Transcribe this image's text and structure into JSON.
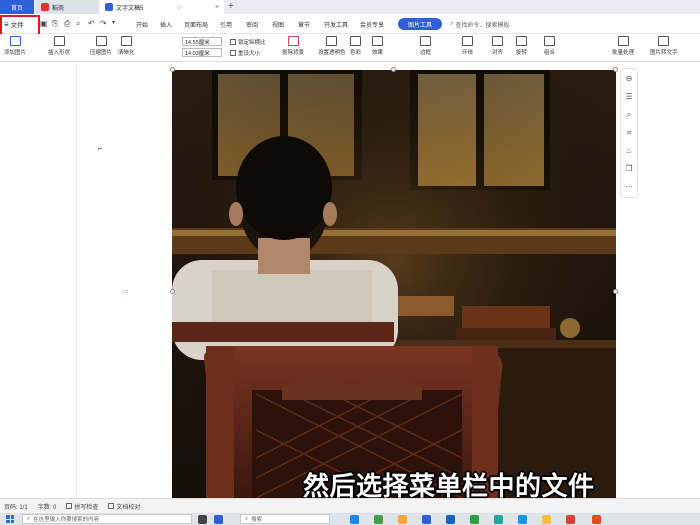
{
  "tabs": [
    {
      "label": "首页"
    },
    {
      "label": "稻壳"
    },
    {
      "label": "文字文稿5"
    }
  ],
  "menu": {
    "file_label": "文件",
    "items": [
      "开始",
      "插入",
      "页面布局",
      "引用",
      "审阅",
      "视图",
      "章节",
      "开发工具",
      "会员专享"
    ],
    "member_pill": "图片工具",
    "search_label": "查找命令、搜索模板"
  },
  "ribbon": {
    "buttons": [
      "添加图片",
      "插入形状",
      "压缩图片",
      "清晰化",
      "抠除背景",
      "设置透明色",
      "色彩",
      "效果",
      "边框",
      "环绕",
      "对齐",
      "旋转",
      "组合",
      "批量处理",
      "图片转文字"
    ],
    "height_value": "14.55厘米",
    "width_value": "14.03厘米",
    "lock_ratio": "锁定纵横比",
    "reset_size": "重设大小"
  },
  "status": {
    "page": "页码: 1/1",
    "words": "字数: 0",
    "spellcheck": "拼写检查",
    "proofread": "文档校对"
  },
  "taskbar": {
    "search_placeholder": "在这里输入你要搜索的内容",
    "second_search": "搜索"
  },
  "subtitle": "然后选择菜单栏中的文件",
  "colors": {
    "accent": "#2f5fd8",
    "highlight": "#e5161d"
  }
}
